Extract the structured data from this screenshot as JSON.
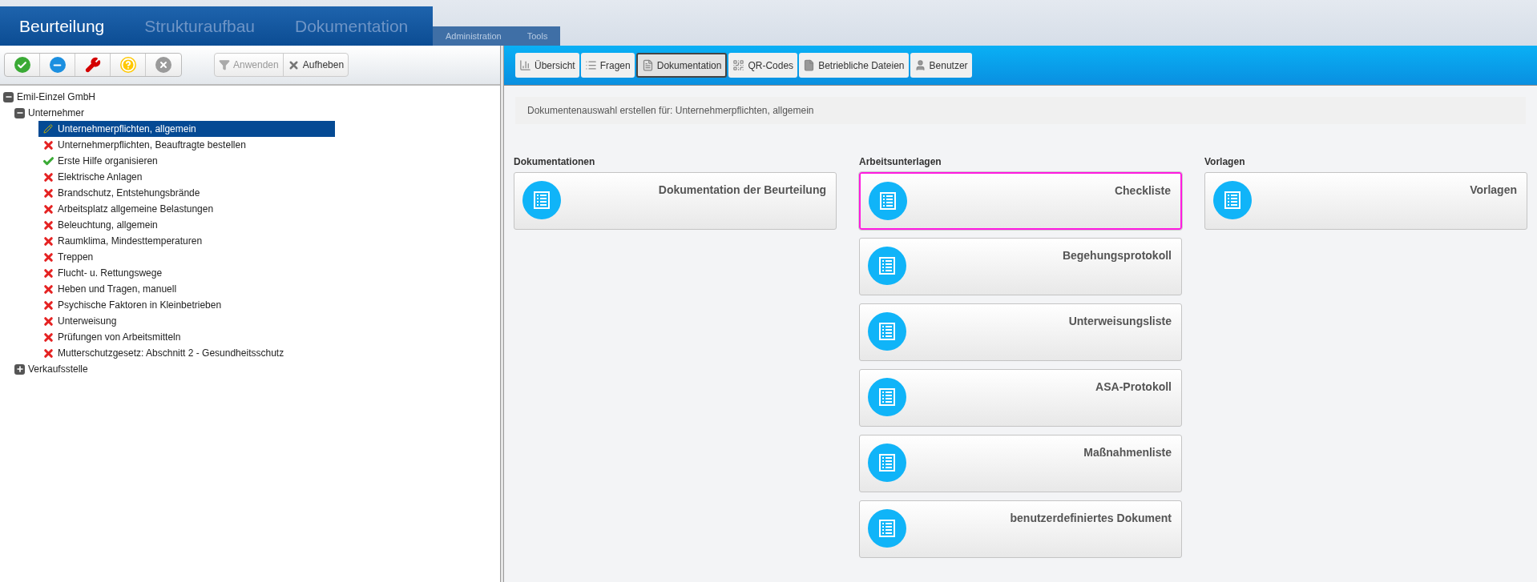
{
  "main_tabs": [
    {
      "label": "Beurteilung",
      "selected": true
    },
    {
      "label": "Strukturaufbau",
      "selected": false
    },
    {
      "label": "Dokumentation",
      "selected": false
    }
  ],
  "sub_tabs": [
    {
      "label": "Administration",
      "selected": false
    },
    {
      "label": "Tools",
      "selected": false
    }
  ],
  "left_toolbar": {
    "status_buttons": [
      {
        "kind": "ok"
      },
      {
        "kind": "minus"
      },
      {
        "kind": "wrench"
      },
      {
        "kind": "question"
      },
      {
        "kind": "cancel"
      }
    ],
    "filter_buttons": [
      {
        "label": "Anwenden",
        "kind": "filter",
        "disabled": true
      },
      {
        "label": "Aufheben",
        "kind": "clear",
        "disabled": false
      }
    ]
  },
  "tree": [
    {
      "label": "Emil-Einzel GmbH",
      "expanded": true,
      "children": [
        {
          "label": "Unternehmer",
          "expanded": true,
          "children": [
            {
              "label": "Unternehmerpflichten, allgemein",
              "kind": "edit",
              "selected": true
            },
            {
              "label": "Unternehmerpflichten, Beauftragte bestellen",
              "kind": "open",
              "selected": false
            },
            {
              "label": "Erste Hilfe organisieren",
              "kind": "done",
              "selected": false
            },
            {
              "label": "Elektrische Anlagen",
              "kind": "open",
              "selected": false
            },
            {
              "label": "Brandschutz, Entstehungsbrände",
              "kind": "open",
              "selected": false
            },
            {
              "label": "Arbeitsplatz allgemeine Belastungen",
              "kind": "open",
              "selected": false
            },
            {
              "label": "Beleuchtung, allgemein",
              "kind": "open",
              "selected": false
            },
            {
              "label": "Raumklima, Mindesttemperaturen",
              "kind": "open",
              "selected": false
            },
            {
              "label": "Treppen",
              "kind": "open",
              "selected": false
            },
            {
              "label": "Flucht- u. Rettungswege",
              "kind": "open",
              "selected": false
            },
            {
              "label": "Heben und Tragen, manuell",
              "kind": "open",
              "selected": false
            },
            {
              "label": "Psychische Faktoren in Kleinbetrieben",
              "kind": "open",
              "selected": false
            },
            {
              "label": "Unterweisung",
              "kind": "open",
              "selected": false
            },
            {
              "label": "Prüfungen von Arbeitsmitteln",
              "kind": "open",
              "selected": false
            },
            {
              "label": "Mutterschutzgesetz: Abschnitt 2 - Gesundheitsschutz",
              "kind": "open",
              "selected": false
            }
          ]
        },
        {
          "label": "Verkaufsstelle",
          "expanded": false
        }
      ]
    }
  ],
  "right_tabs": [
    {
      "label": "Übersicht",
      "kind": "chart",
      "selected": false
    },
    {
      "label": "Fragen",
      "kind": "list",
      "selected": false
    },
    {
      "label": "Dokumentation",
      "kind": "doc",
      "selected": true
    },
    {
      "label": "QR-Codes",
      "kind": "qr",
      "selected": false
    },
    {
      "label": "Betriebliche Dateien",
      "kind": "file",
      "selected": false
    },
    {
      "label": "Benutzer",
      "kind": "user",
      "selected": false
    }
  ],
  "info_text": "Dokumentenauswahl erstellen für: Unternehmerpflichten, allgemein",
  "columns": [
    {
      "heading": "Dokumentationen",
      "cards": [
        {
          "title": "Dokumentation der Beurteilung",
          "selected": false
        }
      ]
    },
    {
      "heading": "Arbeitsunterlagen",
      "cards": [
        {
          "title": "Checkliste",
          "selected": true
        },
        {
          "title": "Begehungsprotokoll",
          "selected": false
        },
        {
          "title": "Unterweisungsliste",
          "selected": false
        },
        {
          "title": "ASA-Protokoll",
          "selected": false
        },
        {
          "title": "Maßnahmenliste",
          "selected": false
        },
        {
          "title": "benutzerdefiniertes Dokument",
          "selected": false
        }
      ]
    },
    {
      "heading": "Vorlagen",
      "cards": [
        {
          "title": "Vorlagen",
          "selected": false
        }
      ]
    }
  ]
}
